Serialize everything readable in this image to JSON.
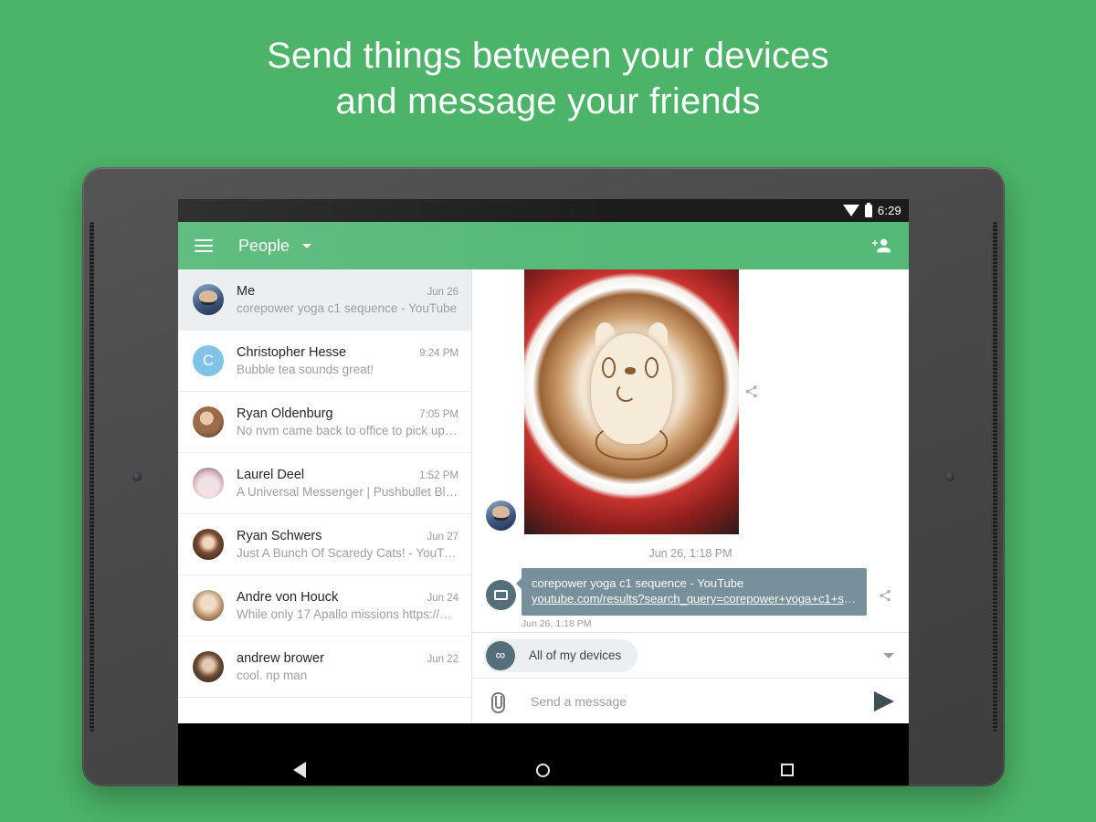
{
  "promo": {
    "line1": "Send things between your devices",
    "line2": "and message your friends"
  },
  "status_bar": {
    "time": "6:29",
    "wifi_icon": "wifi-icon",
    "battery_icon": "battery-icon"
  },
  "app_bar": {
    "menu_icon": "hamburger-menu-icon",
    "title": "People",
    "dropdown_icon": "chevron-down-icon",
    "add_person_icon": "add-person-icon"
  },
  "conversations": [
    {
      "name": "Me",
      "time": "Jun 26",
      "snippet": "corepower yoga c1 sequence - YouTube",
      "avatar": "av-me",
      "initial": "",
      "selected": true
    },
    {
      "name": "Christopher Hesse",
      "time": "9:24 PM",
      "snippet": "Bubble tea sounds great!",
      "avatar": "av-c",
      "initial": "C",
      "selected": false
    },
    {
      "name": "Ryan Oldenburg",
      "time": "7:05 PM",
      "snippet": "No nvm came back to office to pick up s…",
      "avatar": "av-ryano",
      "initial": "",
      "selected": false
    },
    {
      "name": "Laurel Deel",
      "time": "1:52 PM",
      "snippet": "A Universal Messenger | Pushbullet Blog",
      "avatar": "av-laurel",
      "initial": "",
      "selected": false
    },
    {
      "name": "Ryan Schwers",
      "time": "Jun 27",
      "snippet": "Just A Bunch Of Scaredy Cats! - YouTube",
      "avatar": "av-ryans",
      "initial": "",
      "selected": false
    },
    {
      "name": "Andre von Houck",
      "time": "Jun 24",
      "snippet": "While only 17 Apallo missions https://en…",
      "avatar": "av-andre",
      "initial": "",
      "selected": false
    },
    {
      "name": "andrew brower",
      "time": "Jun 22",
      "snippet": "cool. np man",
      "avatar": "av-andrew",
      "initial": "",
      "selected": false
    }
  ],
  "conversation": {
    "photo_message": {
      "alt": "latte art photo of a cartoon creature in a red cup",
      "share_icon": "share-icon",
      "sender_avatar": "me-avatar"
    },
    "day_stamp": "Jun 26, 1:18 PM",
    "link_message": {
      "avatar_icon": "monitor-icon",
      "title": "corepower yoga c1 sequence - YouTube",
      "url": "youtube.com/results?search_query=corepower+yoga+c1+seq…",
      "share_icon": "share-icon",
      "timestamp": "Jun 26, 1:18 PM"
    }
  },
  "device_selector": {
    "icon": "infinity-icon",
    "icon_glyph": "∞",
    "label": "All of my devices",
    "caret_icon": "chevron-down-icon"
  },
  "composer": {
    "attach_icon": "paperclip-icon",
    "placeholder": "Send a message",
    "value": "",
    "send_icon": "send-icon"
  },
  "nav_bar": {
    "back_icon": "back-triangle-icon",
    "home_icon": "home-circle-icon",
    "recents_icon": "recents-square-icon"
  },
  "colors": {
    "background_green": "#4cb468",
    "appbar_green": "#55b978",
    "bubble_slate": "#78909c",
    "selected_row": "#eceff1",
    "avatar_blue": "#7fc4e8"
  }
}
